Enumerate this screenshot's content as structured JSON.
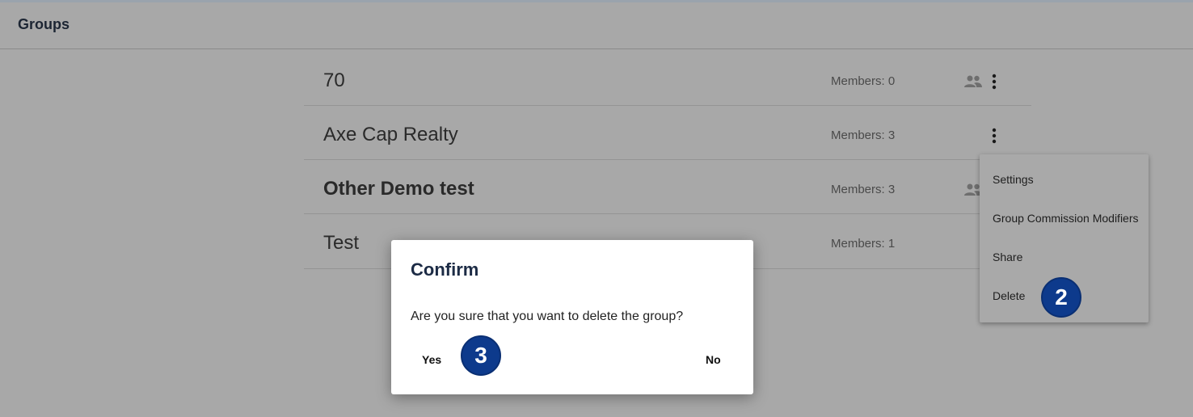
{
  "header": {
    "title": "Groups"
  },
  "groups": [
    {
      "name": "70",
      "members": "Members: 0"
    },
    {
      "name": "Axe Cap Realty",
      "members": "Members: 3"
    },
    {
      "name": "Other Demo test",
      "members": "Members: 3"
    },
    {
      "name": "Test",
      "members": "Members: 1"
    }
  ],
  "menu": {
    "items": [
      "Settings",
      "Group Commission Modifiers",
      "Share",
      "Delete"
    ]
  },
  "dialog": {
    "title": "Confirm",
    "message": "Are you sure that you want to delete the group?",
    "yes_label": "Yes",
    "no_label": "No"
  },
  "annotations": {
    "step2": "2",
    "step3": "3"
  },
  "icons": {
    "group": "group-icon",
    "more": "more-vert-icon"
  },
  "colors": {
    "badge": "#0d3a8c",
    "title": "#1c2b45"
  }
}
